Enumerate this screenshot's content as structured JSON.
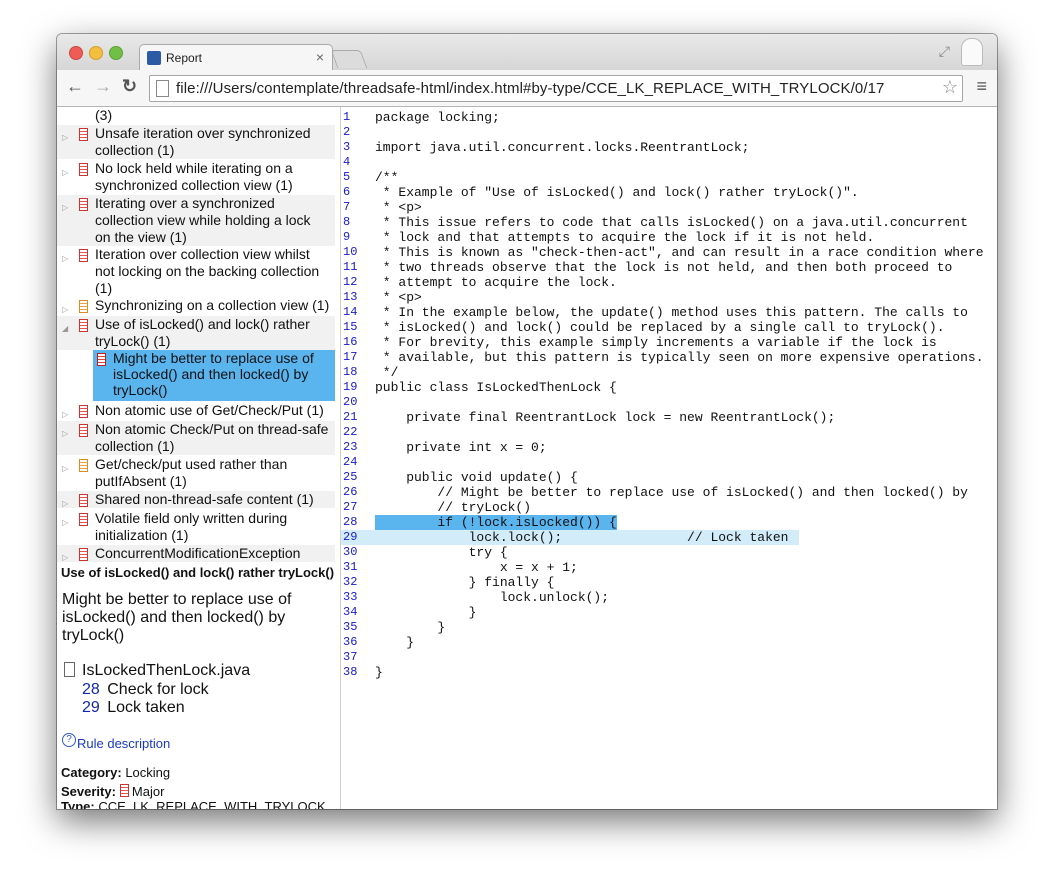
{
  "browser": {
    "tab_title": "Report",
    "tab_close": "×",
    "url": "file:///Users/contemplate/threadsafe-html/index.html#by-type/CCE_LK_REPLACE_WITH_TRYLOCK/0/17",
    "back_glyph": "←",
    "forward_glyph": "→",
    "reload_glyph": "↻",
    "star_glyph": "☆",
    "menu_glyph": "≡",
    "fullscreen_glyph": "⤢"
  },
  "tree": {
    "items": [
      {
        "twisty": "",
        "severity": "",
        "lines": [
          "(3)"
        ]
      },
      {
        "twisty": "▷",
        "severity": "red",
        "lines": [
          "Unsafe iteration over synchronized",
          "collection (1)"
        ]
      },
      {
        "twisty": "▷",
        "severity": "red",
        "lines": [
          "No lock held while iterating on a",
          "synchronized collection view (1)"
        ]
      },
      {
        "twisty": "▷",
        "severity": "red",
        "lines": [
          "Iterating over a synchronized",
          "collection view while holding a lock",
          "on the view (1)"
        ]
      },
      {
        "twisty": "▷",
        "severity": "red",
        "lines": [
          "Iteration over collection view whilst",
          "not locking on the backing collection",
          "(1)"
        ]
      },
      {
        "twisty": "▷",
        "severity": "orange",
        "lines": [
          "Synchronizing on a collection view (1)"
        ]
      },
      {
        "twisty": "◢",
        "severity": "red",
        "lines": [
          "Use of isLocked() and lock() rather",
          "tryLock() (1)"
        ]
      },
      {
        "twisty": "▷",
        "severity": "red",
        "lines": [
          "Non atomic use of Get/Check/Put (1)"
        ]
      },
      {
        "twisty": "▷",
        "severity": "red",
        "lines": [
          "Non atomic Check/Put on thread-safe",
          "collection (1)"
        ]
      },
      {
        "twisty": "▷",
        "severity": "orange",
        "lines": [
          "Get/check/put used rather than",
          "putIfAbsent (1)"
        ]
      },
      {
        "twisty": "▷",
        "severity": "red",
        "lines": [
          "Shared non-thread-safe content (1)"
        ]
      },
      {
        "twisty": "▷",
        "severity": "red",
        "lines": [
          "Volatile field only written during",
          "initialization (1)"
        ]
      },
      {
        "twisty": "▷",
        "severity": "red",
        "lines": [
          "ConcurrentModificationException"
        ]
      }
    ],
    "selected_child": {
      "lines": [
        "Might be better to replace use of",
        "isLocked() and then locked() by",
        "tryLock()"
      ]
    }
  },
  "details": {
    "title": "Use of isLocked() and lock() rather tryLock()",
    "description": "Might be better to replace use of isLocked() and then locked() by tryLock()",
    "file": "IsLockedThenLock.java",
    "locations": [
      {
        "line": "28",
        "label": "Check for lock"
      },
      {
        "line": "29",
        "label": "Lock taken"
      }
    ],
    "help_glyph": "?",
    "rule_link": "Rule description",
    "category_label": "Category:",
    "category": "Locking",
    "severity_label": "Severity:",
    "severity": "Major",
    "type_label": "Type:",
    "type": "CCE_LK_REPLACE_WITH_TRYLOCK"
  },
  "code": {
    "lines": [
      "package locking;",
      "",
      "import java.util.concurrent.locks.ReentrantLock;",
      "",
      "/**",
      " * Example of \"Use of isLocked() and lock() rather tryLock()\".",
      " * <p>",
      " * This issue refers to code that calls isLocked() on a java.util.concurrent",
      " * lock and that attempts to acquire the lock if it is not held.",
      " * This is known as \"check-then-act\", and can result in a race condition where",
      " * two threads observe that the lock is not held, and then both proceed to",
      " * attempt to acquire the lock.",
      " * <p>",
      " * In the example below, the update() method uses this pattern. The calls to",
      " * isLocked() and lock() could be replaced by a single call to tryLock().",
      " * For brevity, this example simply increments a variable if the lock is",
      " * available, but this pattern is typically seen on more expensive operations.",
      " */",
      "public class IsLockedThenLock {",
      "",
      "    private final ReentrantLock lock = new ReentrantLock();",
      "",
      "    private int x = 0;",
      "",
      "    public void update() {",
      "        // Might be better to replace use of isLocked() and then locked() by",
      "        // tryLock()",
      "        if (!lock.isLocked()) {",
      "            lock.lock();                // Lock taken",
      "            try {",
      "                x = x + 1;",
      "            } finally {",
      "                lock.unlock();",
      "            }",
      "        }",
      "    }",
      "",
      "}"
    ],
    "strong_highlight_line": 28,
    "light_highlight_line": 29
  }
}
